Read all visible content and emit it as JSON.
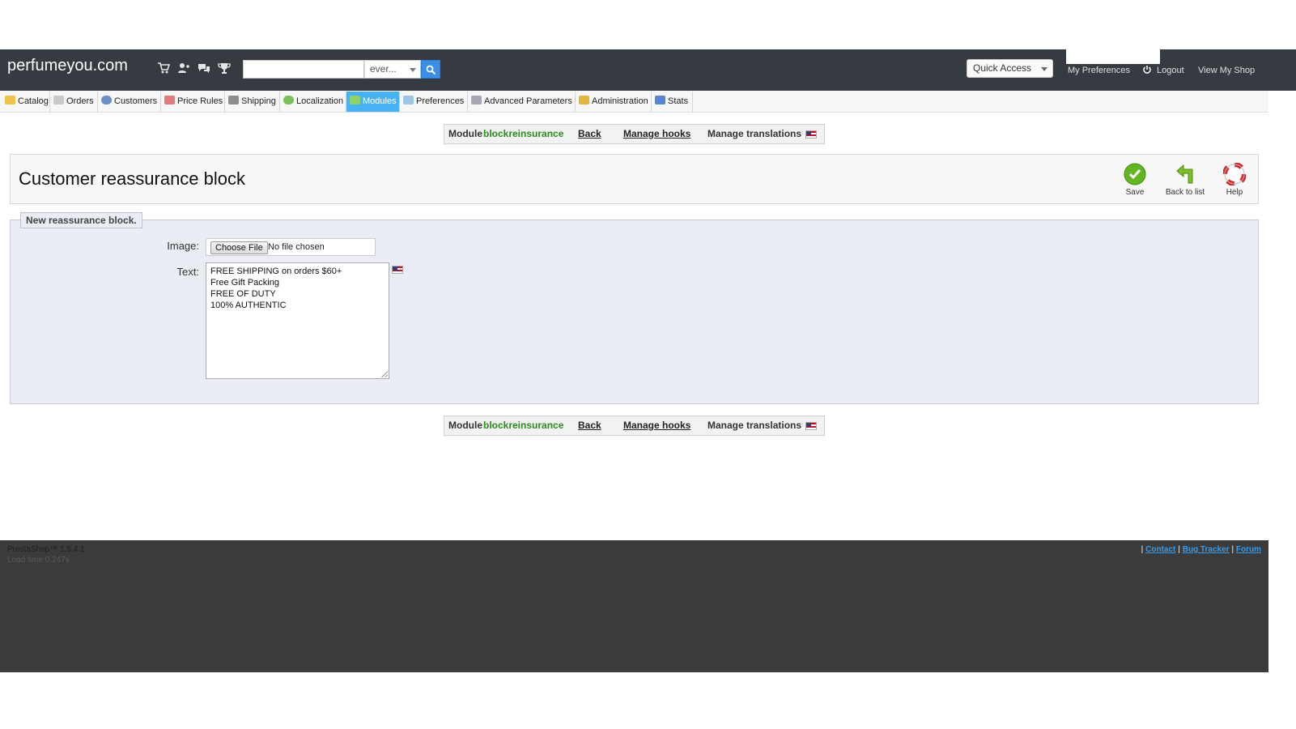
{
  "header": {
    "shop_name": "perfumeyou.com",
    "icons": [
      "cart-icon",
      "customers-icon",
      "messages-icon",
      "trophy-icon"
    ],
    "search": {
      "value": "",
      "placeholder": "",
      "scope": "ever..."
    },
    "quick_access": "Quick Access",
    "my_preferences": "My Preferences",
    "logout": "Logout",
    "view_shop": "View My Shop"
  },
  "menu": {
    "tabs": [
      {
        "label": "Catalog"
      },
      {
        "label": "Orders"
      },
      {
        "label": "Customers"
      },
      {
        "label": "Price Rules"
      },
      {
        "label": "Shipping"
      },
      {
        "label": "Localization"
      },
      {
        "label": "Modules"
      },
      {
        "label": "Preferences"
      },
      {
        "label": "Advanced Parameters"
      },
      {
        "label": "Administration"
      },
      {
        "label": "Stats"
      }
    ],
    "active": "Modules"
  },
  "module_toolbar": {
    "module_prefix": "Module",
    "module_name": "blockreinsurance",
    "back": "Back",
    "manage_hooks": "Manage hooks",
    "manage_translations": "Manage translations"
  },
  "page": {
    "title": "Customer reassurance block",
    "actions": {
      "save": "Save",
      "back_to_list": "Back to list",
      "help": "Help"
    }
  },
  "form": {
    "legend": "New reassurance block.",
    "image_label": "Image:",
    "choose_file": "Choose File",
    "file_status": "No file chosen",
    "text_label": "Text:",
    "text_lines": [
      "FREE SHIPPING on orders $60+",
      "Free Gift Packing",
      "FREE OF DUTY",
      "100% AUTHENTIC"
    ]
  },
  "footer": {
    "version": "PrestaShop™ 1.5.4.1",
    "load_time": "Load time:0.247s",
    "links": {
      "contact": "Contact",
      "bug_tracker": "Bug Tracker",
      "forum": "Forum"
    }
  },
  "colors": {
    "header_bg": "#363a41",
    "active_tab": "#49b2f5",
    "module_name": "#2c8b1f",
    "form_bg": "#ebedf4",
    "footer_bg": "#3b3b3b",
    "footer_link": "#3a9be8"
  }
}
